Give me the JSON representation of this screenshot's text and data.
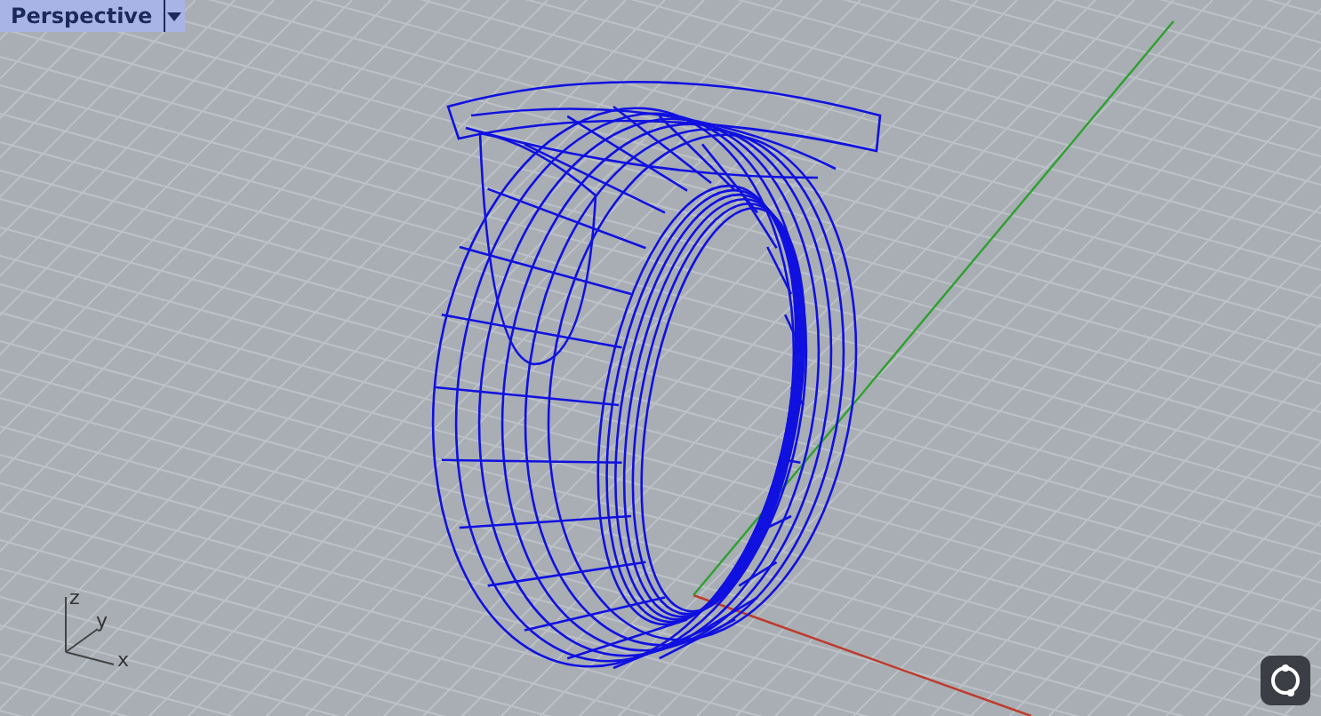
{
  "viewport": {
    "title": "Perspective",
    "axes": [
      {
        "label": "z"
      },
      {
        "label": "y"
      },
      {
        "label": "x"
      }
    ]
  }
}
